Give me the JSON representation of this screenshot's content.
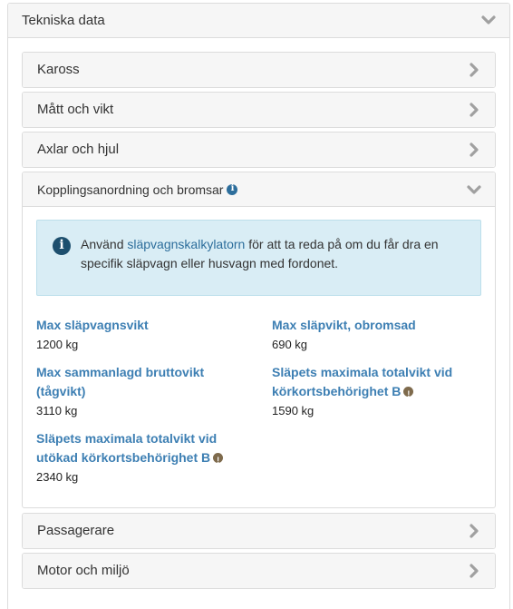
{
  "section": {
    "title": "Tekniska data"
  },
  "panels": {
    "kaross": "Kaross",
    "matt": "Mått och vikt",
    "axlar": "Axlar och hjul",
    "koppling": "Kopplingsanordning och bromsar",
    "passagerare": "Passagerare",
    "motor": "Motor och miljö"
  },
  "info": {
    "before": "Använd ",
    "link": "släpvagnskalkylatorn",
    "after": " för att ta reda på om du får dra en specifik släpvagn eller husvagn med fordonet."
  },
  "specs": {
    "max_slapvagnsvikt": {
      "label": "Max släpvagnsvikt",
      "value": "1200 kg"
    },
    "max_slapvikt_obromsad": {
      "label": "Max släpvikt, obromsad",
      "value": "690 kg"
    },
    "max_sammanlagd": {
      "label": "Max sammanlagd bruttovikt (tågvikt)",
      "value": "3110 kg"
    },
    "slapets_b": {
      "label": "Släpets maximala totalvikt vid körkortsbehörighet B",
      "value": "1590 kg"
    },
    "slapets_utokad_b": {
      "label": "Släpets maximala totalvikt vid utökad körkortsbehörighet B",
      "value": "2340 kg"
    }
  },
  "icons": {
    "chevron_color": "#a0a0a0",
    "info_color": "#2d6e9c",
    "alert_bg": "#d9edf5",
    "label_color": "#3d7fb3"
  }
}
